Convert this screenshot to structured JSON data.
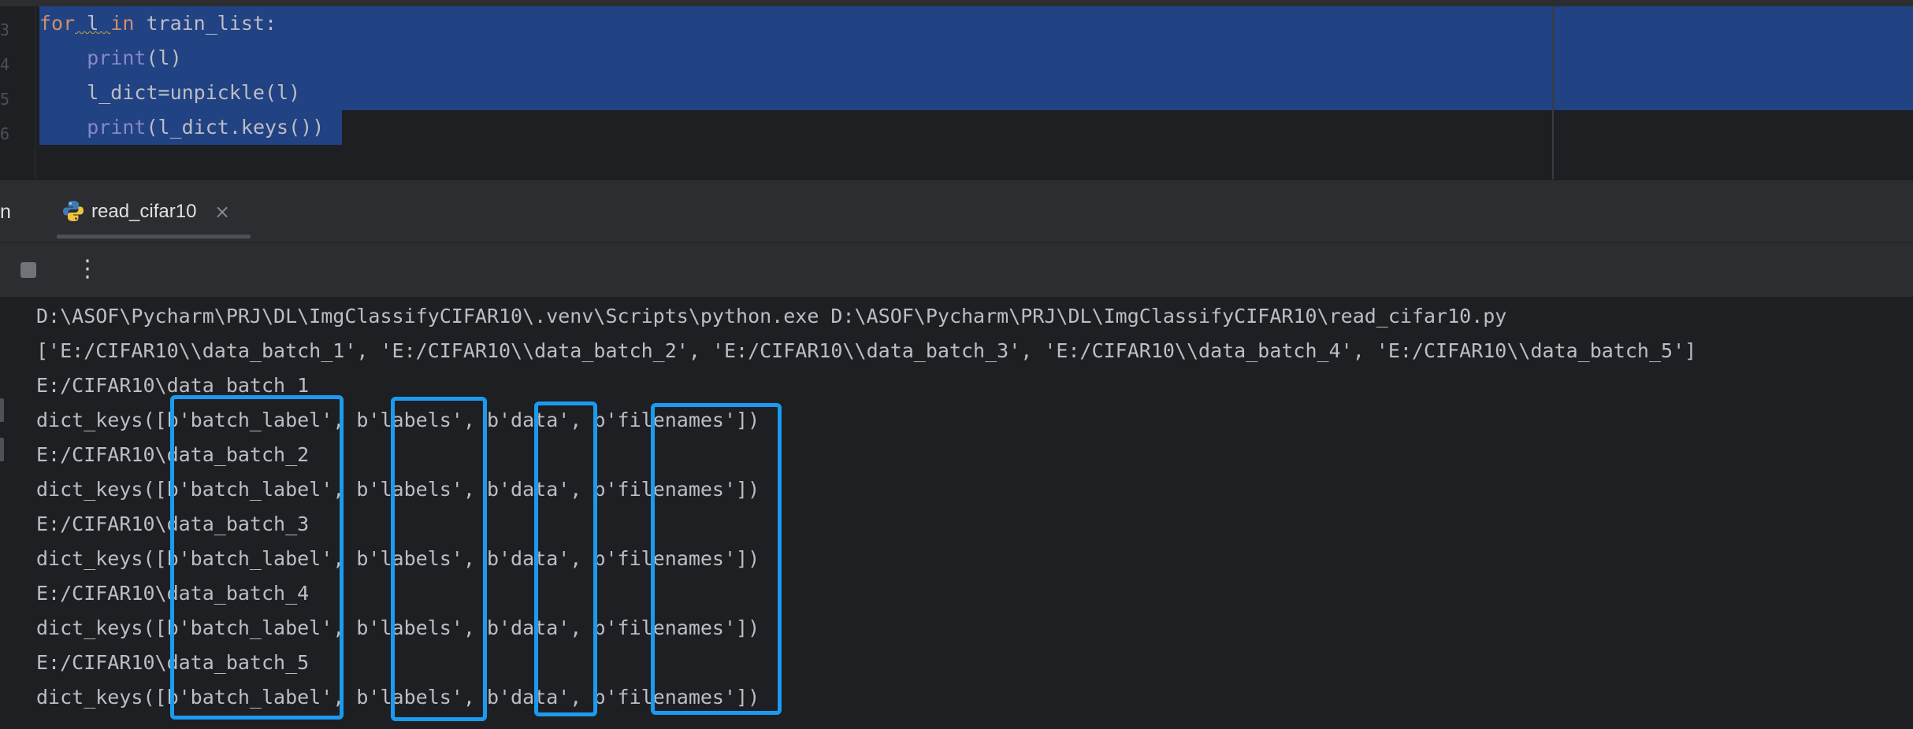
{
  "editor": {
    "line_numbers": [
      "3",
      "4",
      "5",
      "6"
    ],
    "code": {
      "l1_kw_for": "for",
      "l1_var": " l ",
      "l1_kw_in": "in",
      "l1_rest": " train_list:",
      "l2_indent": "    ",
      "l2_fn": "print",
      "l2_rest": "(l)",
      "l3_text": "    l_dict=unpickle(l)",
      "l4_indent": "    ",
      "l4_fn": "print",
      "l4_rest": "(l_dict.keys())"
    }
  },
  "run_window": {
    "title": "n",
    "tab_label": "read_cifar10",
    "tab_close": "×",
    "more_icon": "⋮"
  },
  "console": {
    "lines": [
      "D:\\ASOF\\Pycharm\\PRJ\\DL\\ImgClassifyCIFAR10\\.venv\\Scripts\\python.exe D:\\ASOF\\Pycharm\\PRJ\\DL\\ImgClassifyCIFAR10\\read_cifar10.py",
      "['E:/CIFAR10\\\\data_batch_1', 'E:/CIFAR10\\\\data_batch_2', 'E:/CIFAR10\\\\data_batch_3', 'E:/CIFAR10\\\\data_batch_4', 'E:/CIFAR10\\\\data_batch_5']",
      "E:/CIFAR10\\data_batch_1",
      "dict_keys([b'batch_label', b'labels', b'data', b'filenames'])",
      "E:/CIFAR10\\data_batch_2",
      "dict_keys([b'batch_label', b'labels', b'data', b'filenames'])",
      "E:/CIFAR10\\data_batch_3",
      "dict_keys([b'batch_label', b'labels', b'data', b'filenames'])",
      "E:/CIFAR10\\data_batch_4",
      "dict_keys([b'batch_label', b'labels', b'data', b'filenames'])",
      "E:/CIFAR10\\data_batch_5",
      "dict_keys([b'batch_label', b'labels', b'data', b'filenames'])"
    ]
  },
  "colors": {
    "background": "#1e1f22",
    "panel": "#2b2d30",
    "selection": "#214283",
    "keyword": "#cf8e6d",
    "builtin": "#8888c6",
    "text": "#bcbec4",
    "annotation_box": "#1a9bf0"
  }
}
